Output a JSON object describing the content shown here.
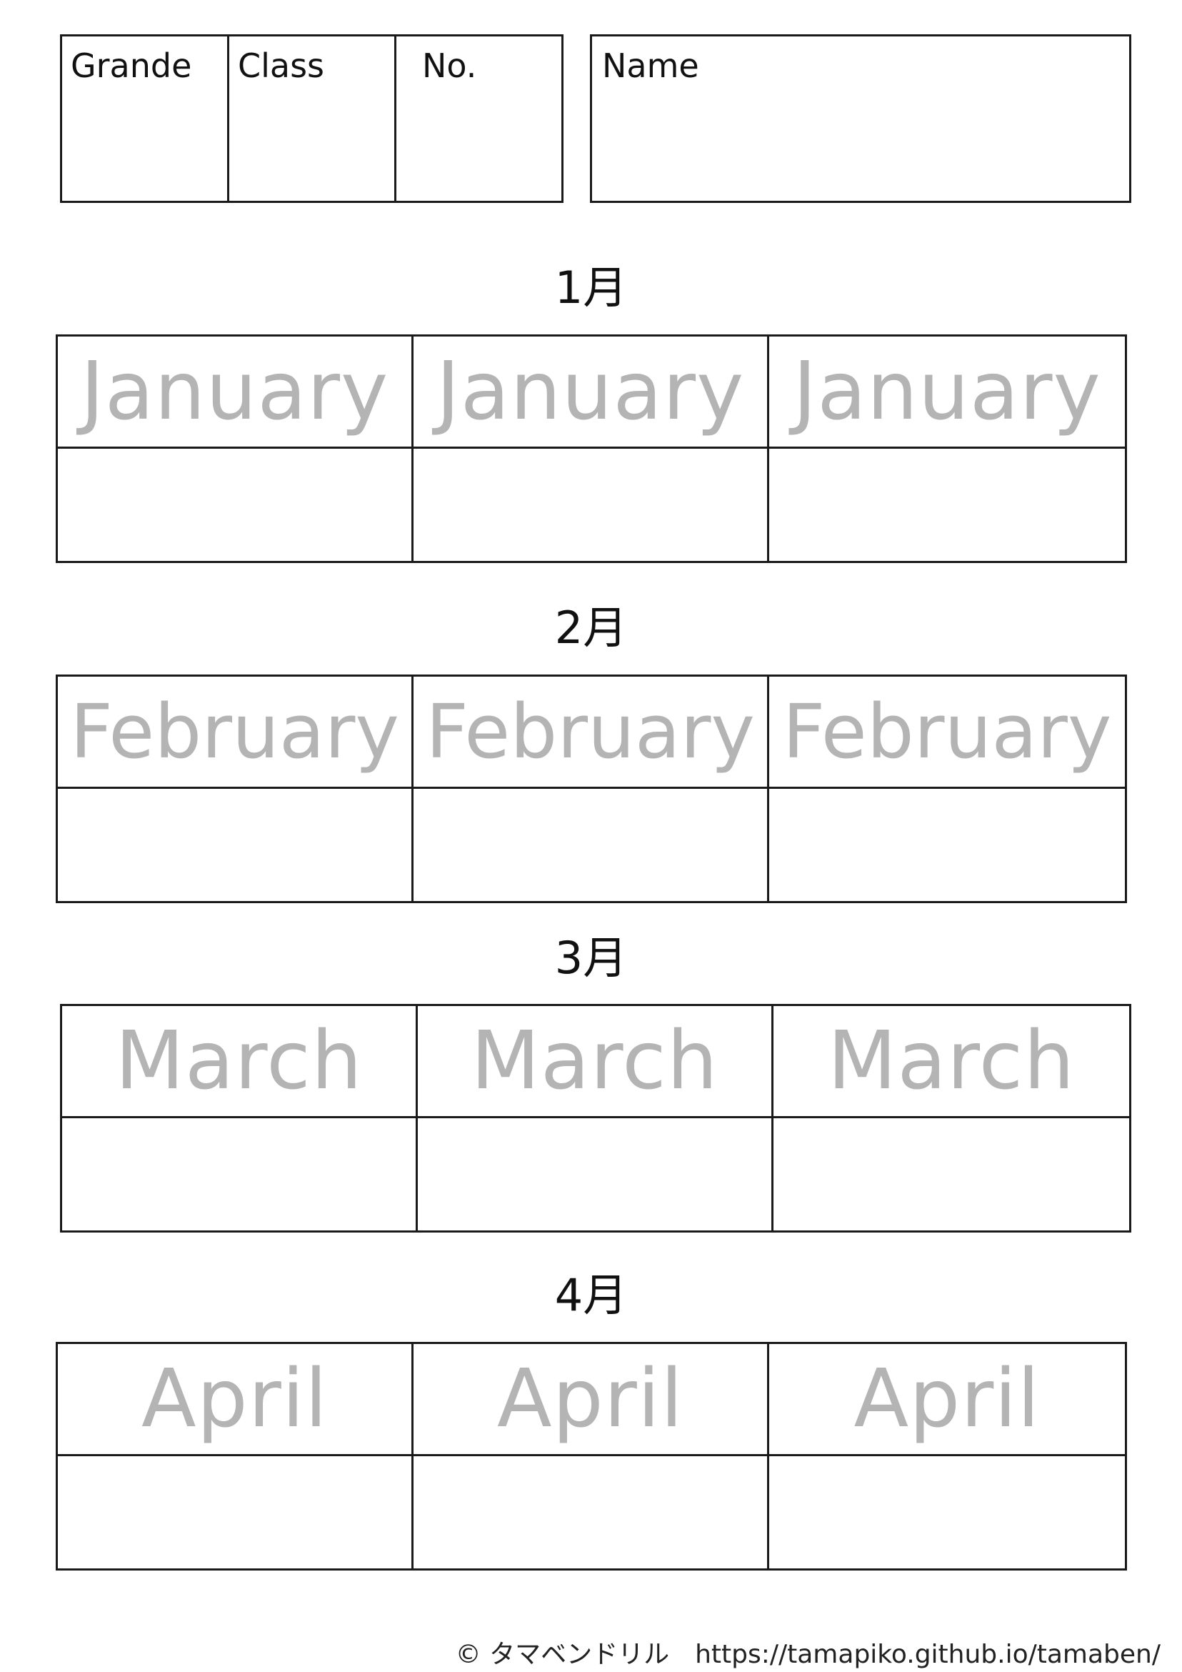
{
  "header": {
    "grade_label": "Grande",
    "class_label": "Class",
    "number_label": "No.",
    "name_label": "Name"
  },
  "months": [
    {
      "title": "1月",
      "word": "January"
    },
    {
      "title": "2月",
      "word": "February"
    },
    {
      "title": "3月",
      "word": "March"
    },
    {
      "title": "4月",
      "word": "April"
    }
  ],
  "footer": {
    "copyright": "© タマベンドリル",
    "url": "https://tamapiko.github.io/tamaben/"
  }
}
